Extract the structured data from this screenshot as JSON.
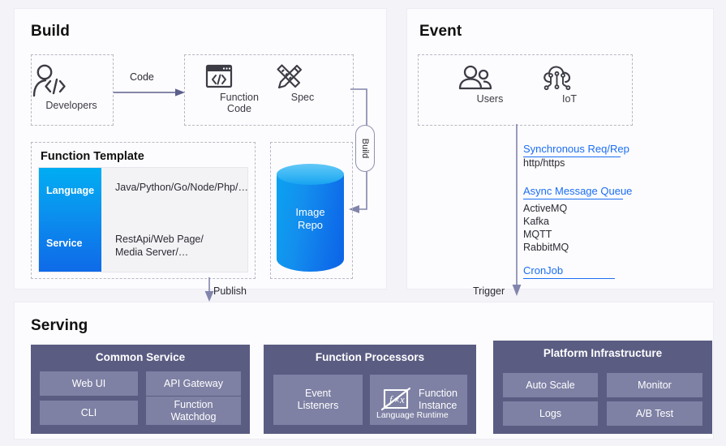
{
  "panels": {
    "build": {
      "title": "Build"
    },
    "event": {
      "title": "Event"
    },
    "serving": {
      "title": "Serving"
    }
  },
  "build": {
    "developers": {
      "label": "Developers",
      "icon": "developer-person-code-icon"
    },
    "code_edge_label": "Code",
    "function_code": {
      "label_line1": "Function",
      "label_line2": "Code",
      "icon": "code-window-icon"
    },
    "spec": {
      "label": "Spec",
      "icon": "pencil-ruler-icon"
    },
    "build_edge_label": "Build",
    "function_template": {
      "title": "Function Template",
      "rows": [
        {
          "key": "Language",
          "value": "Java/Python/Go/Node/Php/…"
        },
        {
          "key": "Service",
          "value": "RestApi/Web Page/\nMedia Server/…"
        }
      ]
    },
    "image_repo": {
      "label_line1": "Image",
      "label_line2": "Repo",
      "icon": "database-cylinder-icon"
    }
  },
  "event": {
    "users": {
      "label": "Users",
      "icon": "users-group-icon"
    },
    "iot": {
      "label": "IoT",
      "icon": "iot-cloud-circuit-icon"
    },
    "groups": [
      {
        "heading": "Synchronous Req/Rep",
        "items": [
          "http/https"
        ]
      },
      {
        "heading": "Async Message Queue",
        "items": [
          "ActiveMQ",
          "Kafka",
          "MQTT",
          "RabbitMQ"
        ]
      },
      {
        "heading": "CronJob",
        "items": []
      }
    ]
  },
  "connectors": {
    "publish": "Publish",
    "trigger": "Trigger"
  },
  "serving": {
    "groups": [
      {
        "title": "Common Service",
        "chips": [
          "Web UI",
          "API Gateway",
          "CLI",
          "Function\nWatchdog"
        ]
      },
      {
        "title": "Function Processors",
        "chips": [
          "Event\nListeners"
        ],
        "fx_chip": {
          "icon": "fx-function-icon",
          "label_line1": "Function",
          "label_line2": "Instance",
          "sublabel": "Language Runtime"
        }
      },
      {
        "title": "Platform Infrastructure",
        "chips": [
          "Auto Scale",
          "Monitor",
          "Logs",
          "A/B Test"
        ]
      }
    ]
  },
  "colors": {
    "page_bg": "#f3f3f8",
    "panel_bg": "#fcfcfe",
    "accent_blue": "#1b6ef3",
    "gradient_top": "#00adf2",
    "gradient_bottom": "#0f6ae8",
    "group_bg": "#5a5c82",
    "chip_bg": "#7e81a4",
    "arrow": "#8184ab"
  }
}
